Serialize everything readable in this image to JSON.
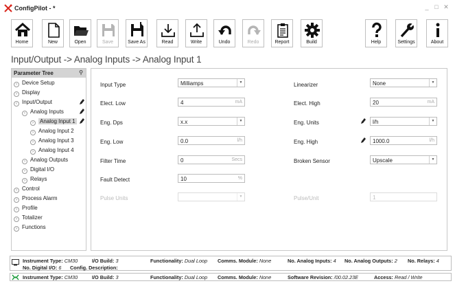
{
  "window": {
    "title": "ConfigPilot - *"
  },
  "toolbar": {
    "home": "Home",
    "new": "New",
    "open": "Open",
    "save": "Save",
    "save_as": "Save As",
    "read": "Read",
    "write": "Write",
    "undo": "Undo",
    "redo": "Redo",
    "report": "Report",
    "build": "Build",
    "help": "Help",
    "settings": "Settings",
    "about": "About"
  },
  "breadcrumb": "Input/Output -> Analog Inputs -> Analog Input 1",
  "tree": {
    "header": "Parameter Tree",
    "items": [
      {
        "label": "Device Setup"
      },
      {
        "label": "Display"
      },
      {
        "label": "Input/Output"
      },
      {
        "label": "Analog Inputs"
      },
      {
        "label": "Analog Input 1"
      },
      {
        "label": "Analog Input 2"
      },
      {
        "label": "Analog Input 3"
      },
      {
        "label": "Analog Input 4"
      },
      {
        "label": "Analog Outputs"
      },
      {
        "label": "Digital I/O"
      },
      {
        "label": "Relays"
      },
      {
        "label": "Control"
      },
      {
        "label": "Process Alarm"
      },
      {
        "label": "Profile"
      },
      {
        "label": "Totalizer"
      },
      {
        "label": "Functions"
      }
    ]
  },
  "form": {
    "input_type": {
      "label": "Input Type",
      "value": "Milliamps"
    },
    "linearizer": {
      "label": "Linearizer",
      "value": "None"
    },
    "elect_low": {
      "label": "Elect. Low",
      "value": "4",
      "unit": "mA"
    },
    "elect_high": {
      "label": "Elect. High",
      "value": "20",
      "unit": "mA"
    },
    "eng_dps": {
      "label": "Eng. Dps",
      "value": "x.x"
    },
    "eng_units": {
      "label": "Eng. Units",
      "value": "l/h"
    },
    "eng_low": {
      "label": "Eng. Low",
      "value": "0.0",
      "unit": "l/h"
    },
    "eng_high": {
      "label": "Eng. High",
      "value": "1000.0",
      "unit": "l/h"
    },
    "filter_time": {
      "label": "Filter Time",
      "value": "0",
      "unit": "Secs"
    },
    "broken_sensor": {
      "label": "Broken Sensor",
      "value": "Upscale"
    },
    "fault_detect": {
      "label": "Fault Detect",
      "value": "10",
      "unit": "%"
    },
    "pulse_units": {
      "label": "Pulse Units",
      "value": ""
    },
    "pulse_unit": {
      "label": "Pulse/Unit",
      "value": "1"
    }
  },
  "status1": {
    "instrument_type_label": "Instrument Type:",
    "instrument_type": "CM30",
    "io_build_label": "I/O Build:",
    "io_build": "3",
    "functionality_label": "Functionality:",
    "functionality": "Dual Loop",
    "comms_label": "Comms. Module:",
    "comms": "None",
    "analog_inputs_label": "No. Analog Inputs:",
    "analog_inputs": "4",
    "analog_outputs_label": "No. Analog Outputs:",
    "analog_outputs": "2",
    "relays_label": "No. Relays:",
    "relays": "4",
    "digital_io_label": "No. Digital I/O:",
    "digital_io": "6",
    "config_desc_label": "Config. Description:"
  },
  "status2": {
    "instrument_type_label": "Instrument Type:",
    "instrument_type": "CM30",
    "io_build_label": "I/O Build:",
    "io_build": "3",
    "functionality_label": "Functionality:",
    "functionality": "Dual Loop",
    "comms_label": "Comms. Module:",
    "comms": "None",
    "software_rev_label": "Software Revision:",
    "software_rev": "/00.02.23E",
    "access_label": "Access:",
    "access": "Read / Write"
  },
  "colors": {
    "accent_red": "#d9261c",
    "connection_green": "#1a9a3a",
    "tree_header_bg": "#d4d4d4"
  }
}
